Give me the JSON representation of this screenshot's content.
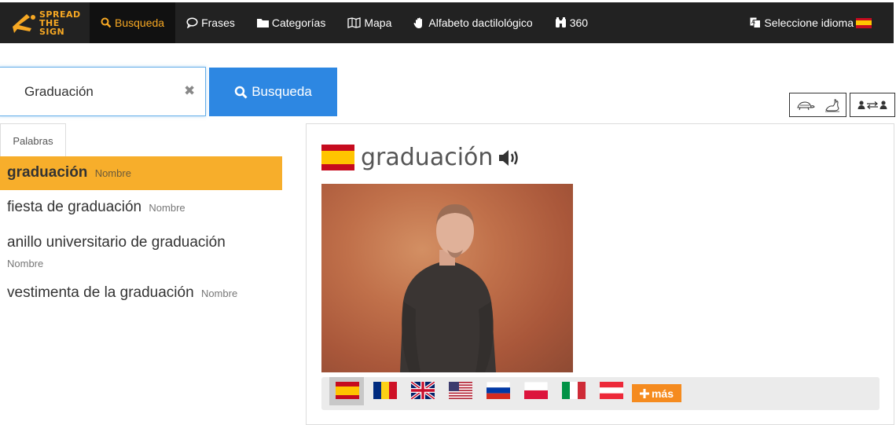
{
  "navbar": {
    "logo_text": [
      "SPREAD",
      "THE",
      "SIGN"
    ],
    "items": [
      {
        "label": "Busqueda",
        "icon": "search-icon",
        "active": true
      },
      {
        "label": "Frases",
        "icon": "comment-icon"
      },
      {
        "label": "Categorías",
        "icon": "folder-icon"
      },
      {
        "label": "Mapa",
        "icon": "map-icon"
      },
      {
        "label": "Alfabeto dactilológico",
        "icon": "hand-icon"
      },
      {
        "label": "360",
        "icon": "binoculars-icon"
      }
    ],
    "language_label": "Seleccione idioma",
    "accent_color": "#f7a823"
  },
  "search": {
    "value": "Graduación",
    "button_label": "Busqueda"
  },
  "tabs": {
    "words_label": "Palabras"
  },
  "results": [
    {
      "word": "graduación",
      "type": "Nombre",
      "selected": true
    },
    {
      "word": "fiesta de graduación",
      "type": "Nombre"
    },
    {
      "word": "anillo universitario de graduación",
      "type": "Nombre"
    },
    {
      "word": "vestimenta de la graduación",
      "type": "Nombre"
    }
  ],
  "detail": {
    "word": "graduación",
    "flag": "spain-flag",
    "more_label": "más",
    "languages": [
      "spain-flag",
      "romania-flag",
      "uk-flag",
      "usa-flag",
      "russia-flag",
      "poland-flag",
      "italy-flag",
      "austria-flag"
    ]
  }
}
